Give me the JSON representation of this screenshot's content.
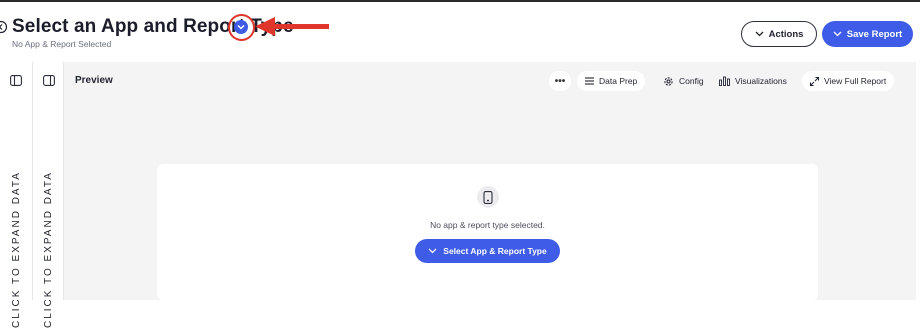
{
  "header": {
    "title": "Select an App and Report Type",
    "subtitle": "No App & Report Selected",
    "actions_label": "Actions",
    "save_label": "Save Report"
  },
  "sidebars": [
    {
      "label": "CLICK TO EXPAND DATA"
    },
    {
      "label": "CLICK TO EXPAND DATA"
    }
  ],
  "preview": {
    "title": "Preview",
    "toolbar": {
      "more_label": "•••",
      "data_prep_label": "Data Prep",
      "config_label": "Config",
      "visualizations_label": "Visualizations",
      "view_full_report_label": "View Full Report"
    },
    "empty_state": {
      "message": "No app & report type selected.",
      "button_label": "Select App & Report Type"
    }
  },
  "colors": {
    "accent": "#3f5ce8",
    "annotation": "#e0352b",
    "panel_background": "#f4f4f5"
  }
}
